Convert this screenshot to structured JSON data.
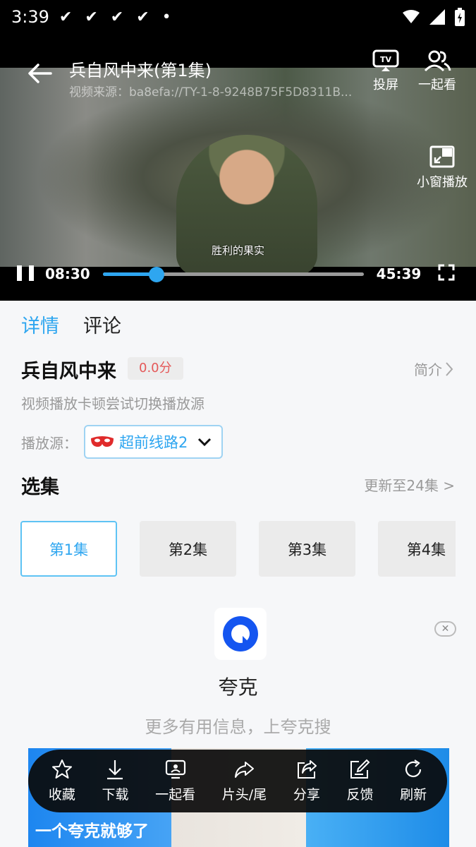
{
  "status_bar": {
    "time": "3:39",
    "checks": [
      "✔",
      "✔",
      "✔",
      "✔"
    ],
    "dot": "•"
  },
  "player": {
    "title": "兵自风中来(第1集)",
    "source": "视频来源：ba8efa://TY-1-8-9248B75F5D8311B...",
    "cast_label": "投屏",
    "watch_together_label": "一起看",
    "pip_label": "小窗播放",
    "subtitle": "胜利的果实",
    "current_time": "08:30",
    "total_time": "45:39",
    "progress": 0.205,
    "accent_color": "#2ea6f0"
  },
  "tabs": {
    "details": "详情",
    "comments": "评论"
  },
  "info": {
    "title": "兵自风中来",
    "score": "0.0分",
    "intro_label": "简介",
    "tip": "视频播放卡顿尝试切换播放源",
    "source_label": "播放源：",
    "source_value": "超前线路2"
  },
  "episodes": {
    "title": "选集",
    "update_text": "更新至24集 >",
    "items": [
      "第1集",
      "第2集",
      "第3集",
      "第4集"
    ],
    "selected_index": 0
  },
  "ad": {
    "name": "夸克",
    "desc": "更多有用信息，上夸克搜",
    "close_label": "✕",
    "slogan": "一个夸克就够了"
  },
  "actions": [
    {
      "label": "收藏",
      "icon": "star-icon"
    },
    {
      "label": "下载",
      "icon": "download-icon"
    },
    {
      "label": "一起看",
      "icon": "watch-together-icon"
    },
    {
      "label": "片头/尾",
      "icon": "skip-intro-icon"
    },
    {
      "label": "分享",
      "icon": "share-icon"
    },
    {
      "label": "反馈",
      "icon": "feedback-icon"
    },
    {
      "label": "刷新",
      "icon": "refresh-icon"
    }
  ]
}
